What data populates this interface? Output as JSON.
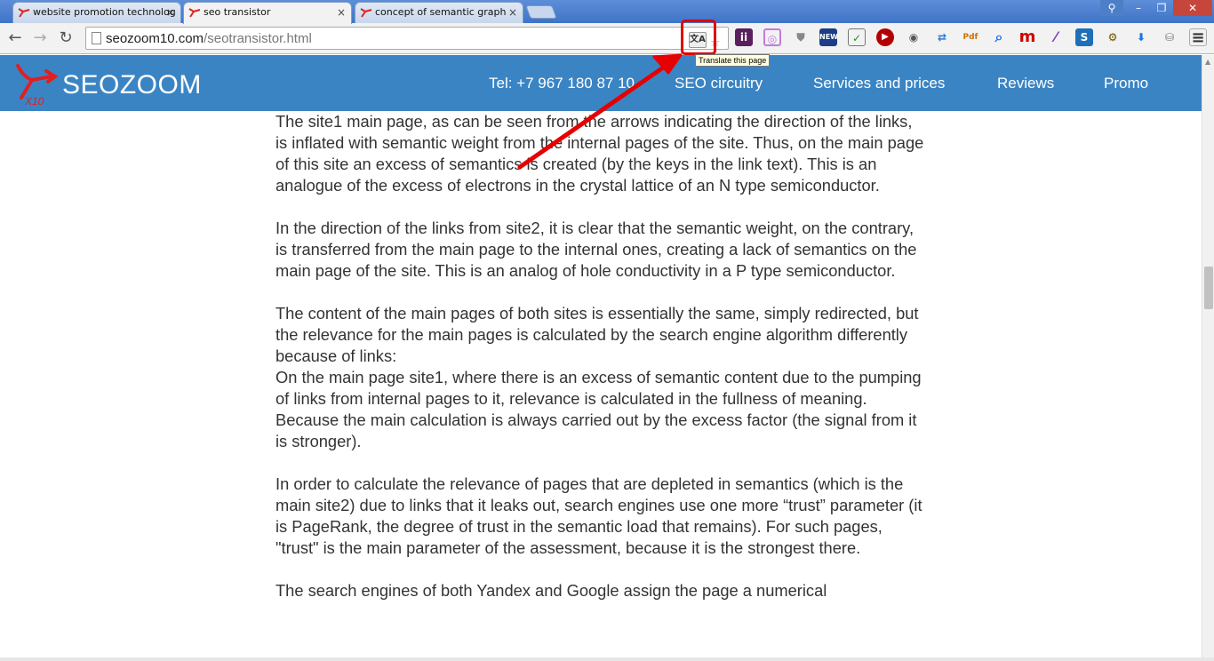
{
  "browser": {
    "tabs": [
      {
        "title": "website promotion technolog",
        "active": false
      },
      {
        "title": "seo transistor",
        "active": true
      },
      {
        "title": "concept of semantic graph",
        "active": false
      }
    ],
    "tab_close_glyph": "×",
    "url": {
      "host": "seozoom10.com",
      "path": "/seotransistor.html"
    },
    "tooltip": "Translate this page",
    "window_controls": {
      "minimize": "–",
      "restore": "❐",
      "close": "✕"
    },
    "nav": {
      "back": "←",
      "forward": "→",
      "reload": "↻"
    }
  },
  "site": {
    "logo_badge": "X10",
    "logo_text": "SEOZOOM",
    "nav": [
      {
        "label": "Tel: +7 967 180 87 10"
      },
      {
        "label": "SEO circuitry"
      },
      {
        "label": "Services and prices"
      },
      {
        "label": "Reviews"
      },
      {
        "label": "Promo"
      }
    ],
    "header_color": "#3a84c4"
  },
  "content": {
    "paragraphs": [
      "The site1 main page, as can be seen from the arrows indicating the direction of the links, is inflated with semantic weight from the internal pages of the site. Thus, on the main page of this site an excess of semantics is created (by the keys in the link text). This is an analogue of the excess of electrons in the crystal lattice of an N type semiconductor.",
      "In the direction of the links from site2, it is clear that the semantic weight, on the contrary, is transferred from the main page to the internal ones, creating a lack of semantics on the main page of the site. This is an analog of hole conductivity in a P type semiconductor.",
      "The content of the main pages of both sites is essentially the same, simply redirected, but the relevance for the main pages is calculated by the search engine algorithm differently because of links:",
      "On the main page site1, where there is an excess of semantic content due to the pumping of links from internal pages to it, relevance is calculated in the fullness of meaning. Because the main calculation is always carried out by the excess factor (the signal from it is stronger).",
      "In order to calculate the relevance of pages that are depleted in semantics (which is the main site2) due to links that it leaks out, search engines use one more “trust” parameter (it is PageRank, the degree of trust in the semantic load that remains). For such pages, \"trust\" is the main parameter of the assessment, because it is the strongest there.",
      "The search engines of both Yandex and Google assign the page a numerical"
    ]
  },
  "extensions": [
    {
      "name": "translate-icon",
      "glyph": "文A"
    },
    {
      "name": "extension-purple-icon",
      "glyph": "ii"
    },
    {
      "name": "instagram-icon",
      "glyph": "◎"
    },
    {
      "name": "shield-icon",
      "glyph": "⛊"
    },
    {
      "name": "new-badge-icon",
      "glyph": "NEW"
    },
    {
      "name": "monitor-check-icon",
      "glyph": "✓"
    },
    {
      "name": "play-icon",
      "glyph": "▶"
    },
    {
      "name": "camera-icon",
      "glyph": "◉"
    },
    {
      "name": "share-icon",
      "glyph": "⇄"
    },
    {
      "name": "pdf-icon",
      "glyph": "Pdf"
    },
    {
      "name": "search-icon",
      "glyph": "⌕"
    },
    {
      "name": "m-icon",
      "glyph": "m"
    },
    {
      "name": "feather-icon",
      "glyph": "⁄"
    },
    {
      "name": "s-icon",
      "glyph": "S"
    },
    {
      "name": "seo-tool-icon",
      "glyph": "⚙"
    },
    {
      "name": "download-icon",
      "glyph": "⬇"
    },
    {
      "name": "database-icon",
      "glyph": "⛁"
    },
    {
      "name": "menu-icon",
      "glyph": "≡"
    }
  ]
}
